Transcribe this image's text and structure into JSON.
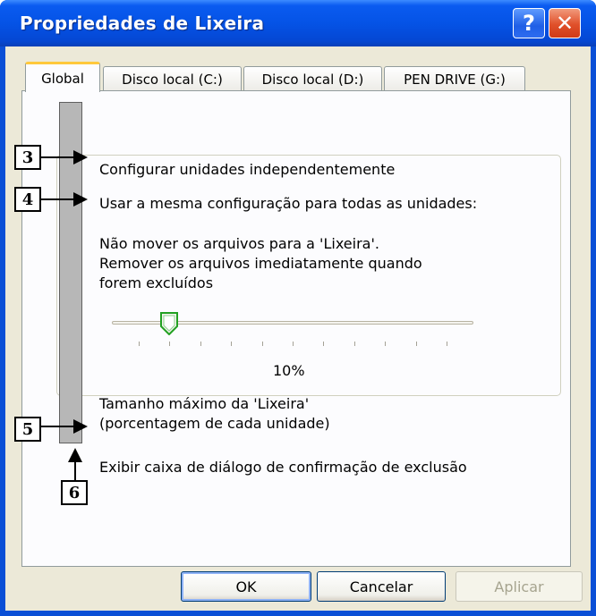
{
  "window": {
    "title": "Propriedades de Lixeira",
    "help_glyph": "?",
    "close_glyph": "✕"
  },
  "tabs": [
    {
      "label": "Global",
      "selected": true
    },
    {
      "label": "Disco local (C:)",
      "selected": false
    },
    {
      "label": "Disco local (D:)",
      "selected": false
    },
    {
      "label": "PEN DRIVE (G:)",
      "selected": false
    }
  ],
  "options": {
    "configure_independently": "Configurar unidades independentemente",
    "use_same_config": "Usar a mesma configuração para todas as unidades:",
    "do_not_move": [
      "Não mover os arquivos para a 'Lixeira'.",
      "Remover os arquivos imediatamente quando",
      "forem excluídos"
    ],
    "slider_value": 0.1,
    "slider_value_label": "10%",
    "max_size": [
      "Tamanho máximo da 'Lixeira'",
      "(porcentagem de cada unidade)"
    ],
    "confirm_dialog": "Exibir caixa de diálogo de confirmação de exclusão"
  },
  "buttons": {
    "ok": "OK",
    "cancel": "Cancelar",
    "apply": "Aplicar",
    "apply_enabled": false
  },
  "callouts": {
    "c3": "3",
    "c4": "4",
    "c5": "5",
    "c6": "6"
  },
  "colors": {
    "titlebar": "#0553e6",
    "dialog_bg": "#ece9d8",
    "active_tab_accent": "#ffc83c",
    "slider_thumb_accent": "#21a121"
  },
  "icons": {
    "help": "help-icon",
    "close": "close-icon",
    "slider_thumb": "slider-thumb-icon"
  }
}
